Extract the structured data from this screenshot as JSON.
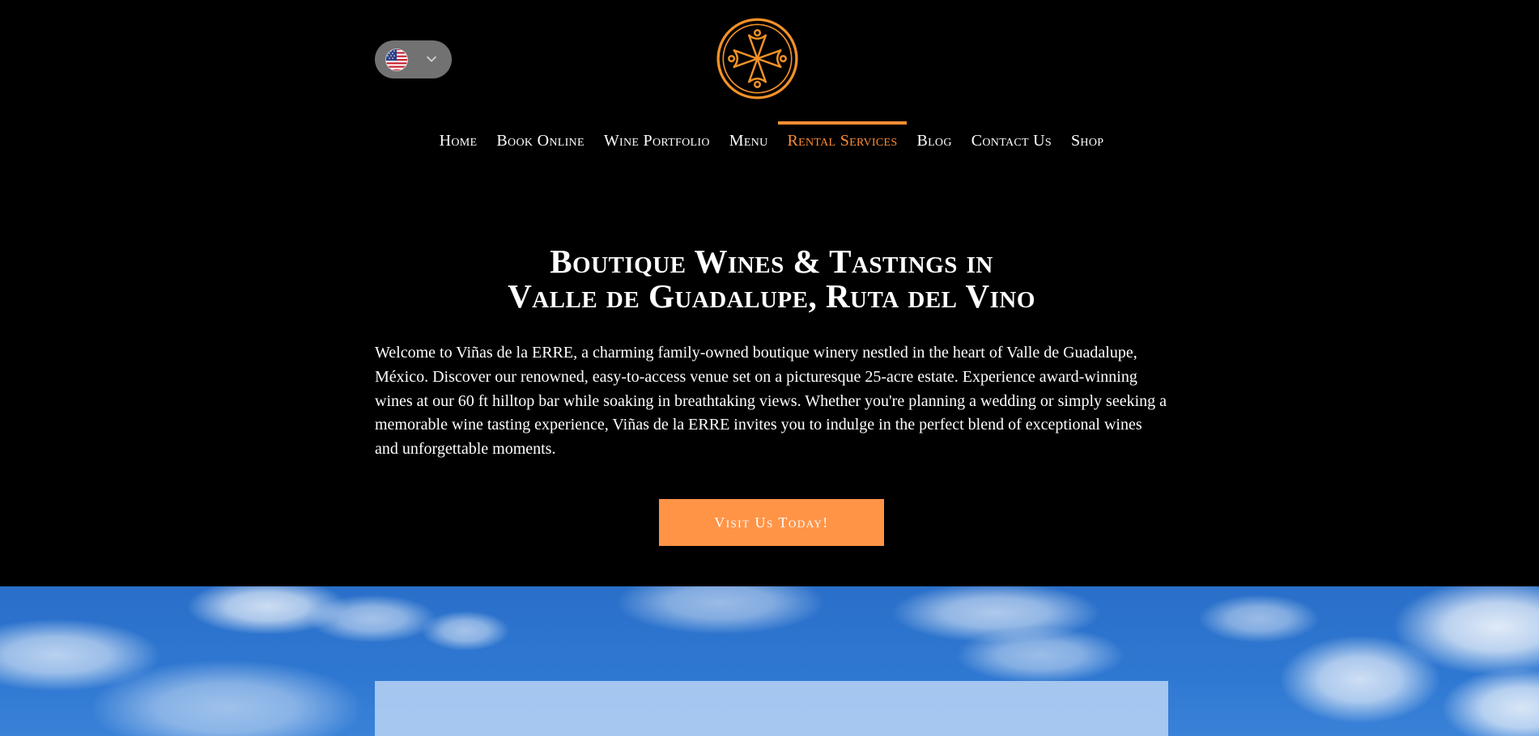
{
  "header": {
    "language": {
      "selected": "English",
      "flag_icon": "us-flag-icon",
      "chevron_icon": "chevron-down-icon"
    },
    "logo_icon": "maltese-cross-emblem-icon",
    "nav": {
      "items": [
        {
          "label": "Home",
          "active": false
        },
        {
          "label": "Book Online",
          "active": false
        },
        {
          "label": "Wine Portfolio",
          "active": false
        },
        {
          "label": "Menu",
          "active": false
        },
        {
          "label": "Rental Services",
          "active": true
        },
        {
          "label": "Blog",
          "active": false
        },
        {
          "label": "Contact Us",
          "active": false
        },
        {
          "label": "Shop",
          "active": false
        }
      ]
    }
  },
  "hero": {
    "title_line1": "Boutique Wines & Tastings in",
    "title_line2": "Valle de Guadalupe, Ruta del Vino",
    "body": "Welcome to Viñas de la ERRE, a charming family-owned boutique winery nestled in the heart of Valle de Guadalupe, México. Discover our renowned, easy-to-access venue set on a picturesque 25-acre estate. Experience award-winning wines at our 60 ft hilltop bar while soaking in breathtaking views. Whether you're planning a wedding or simply seeking a memorable wine tasting experience, Viñas de la ERRE invites you to indulge in the perfect blend of exceptional wines and unforgettable moments.",
    "cta_label": "Visit Us Today!"
  },
  "colors": {
    "background": "#000000",
    "accent": "#ff8c33",
    "cta_background": "#ff9447",
    "text": "#ffffff",
    "language_pill": "#727272",
    "sky": "#2f78d2"
  }
}
